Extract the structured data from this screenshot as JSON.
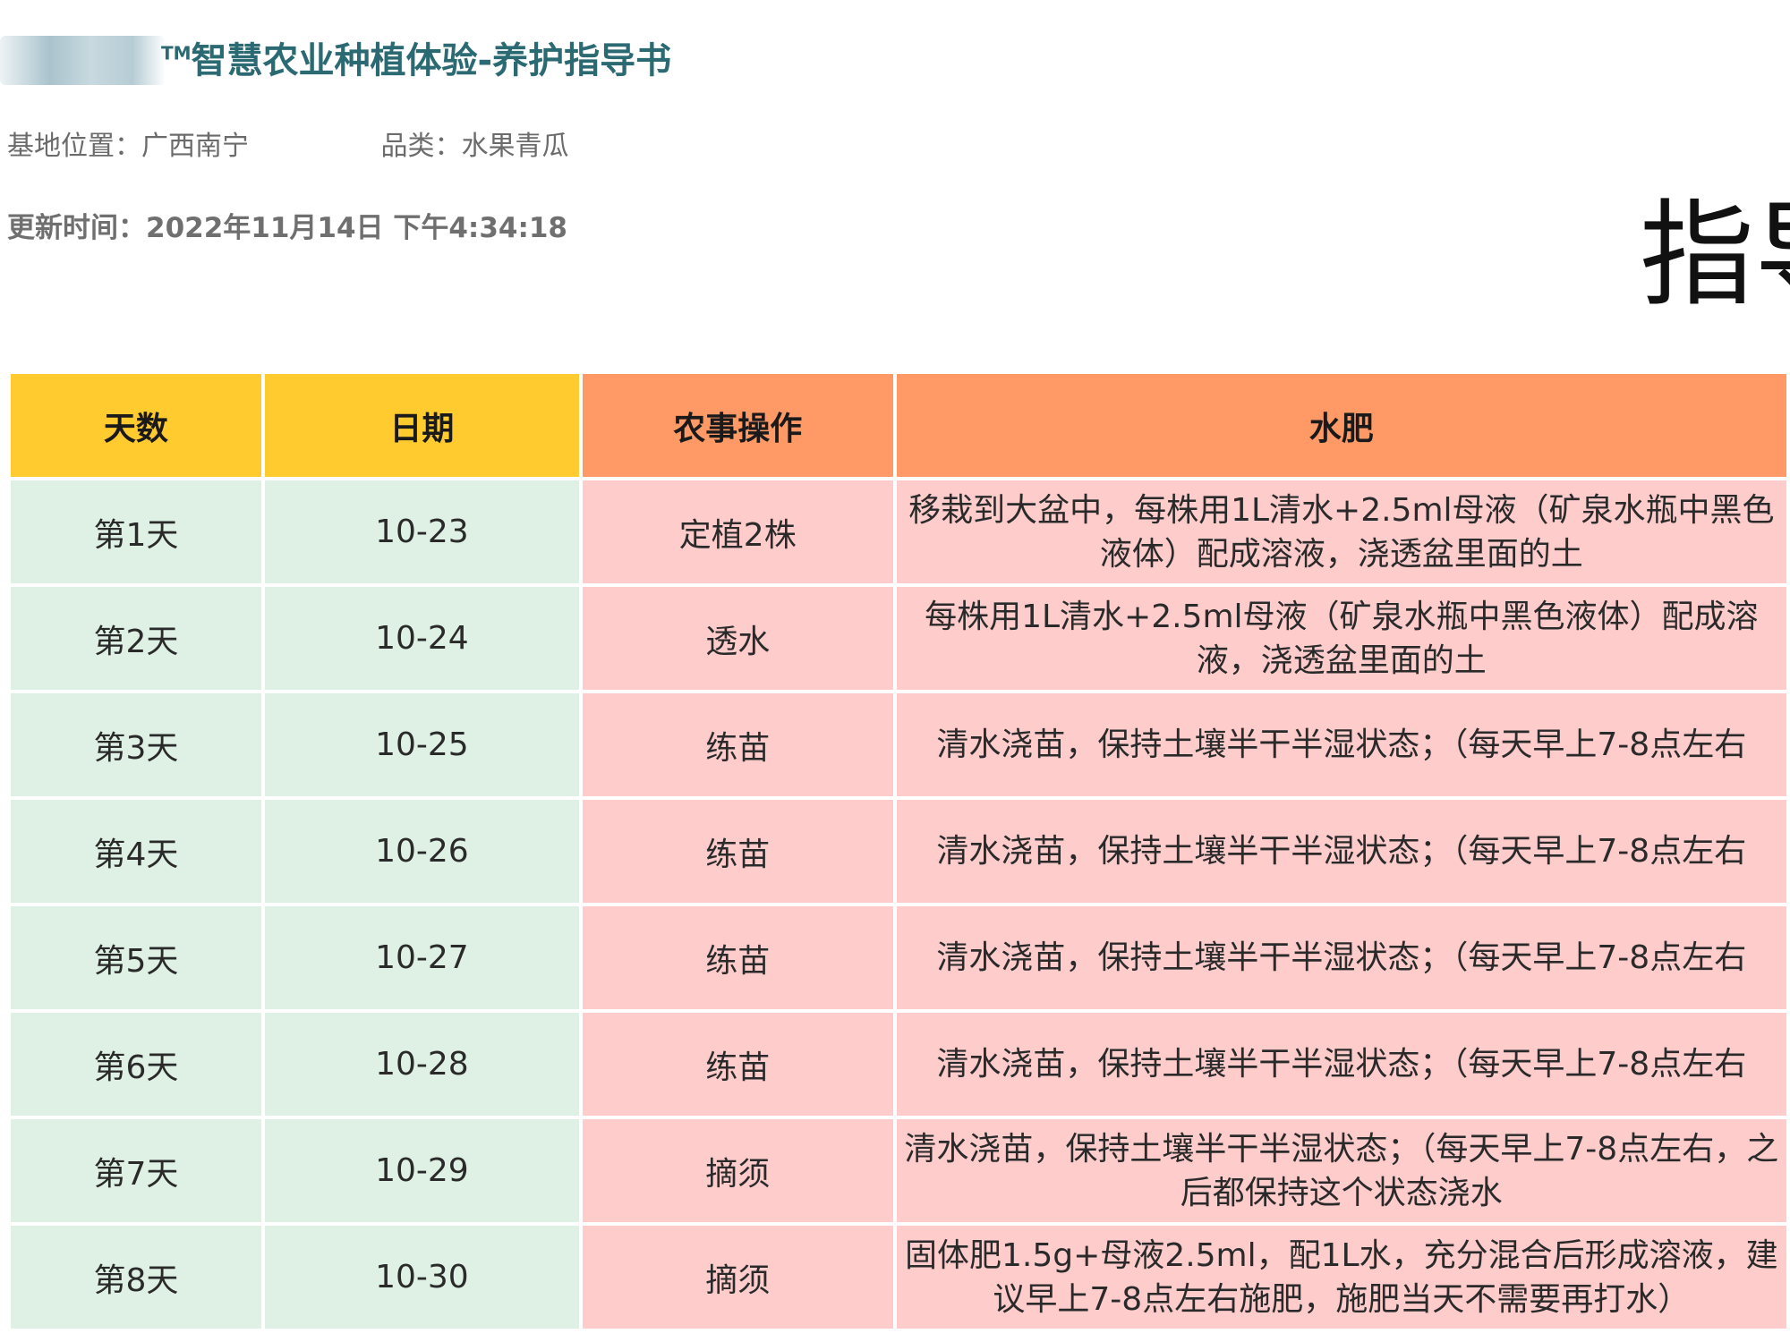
{
  "header": {
    "tm": "TM",
    "title": "智慧农业种植体验-养护指导书"
  },
  "meta": {
    "location_label": "基地位置：",
    "location_value": "广西南宁",
    "category_label": "品类：",
    "category_value": "水果青瓜",
    "updated_label": "更新时间：",
    "updated_value": "2022年11月14日 下午4:34:18"
  },
  "side_heading": "指导",
  "colors": {
    "title": "#2b6a72",
    "header_yellow": "#ffcb2e",
    "header_orange": "#ff9a67",
    "cell_green": "#dff1e5",
    "cell_pink": "#ffcccc"
  },
  "table": {
    "headers": {
      "day": "天数",
      "date": "日期",
      "operation": "农事操作",
      "fertilizer": "水肥"
    },
    "rows": [
      {
        "day": "第1天",
        "date": "10-23",
        "operation": "定植2株",
        "fertilizer": "移栽到大盆中，每株用1L清水+2.5ml母液（矿泉水瓶中黑色液体）配成溶液，浇透盆里面的土"
      },
      {
        "day": "第2天",
        "date": "10-24",
        "operation": "透水",
        "fertilizer": "每株用1L清水+2.5ml母液（矿泉水瓶中黑色液体）配成溶液，浇透盆里面的土"
      },
      {
        "day": "第3天",
        "date": "10-25",
        "operation": "练苗",
        "fertilizer": "清水浇苗，保持土壤半干半湿状态；（每天早上7-8点左右"
      },
      {
        "day": "第4天",
        "date": "10-26",
        "operation": "练苗",
        "fertilizer": "清水浇苗，保持土壤半干半湿状态；（每天早上7-8点左右"
      },
      {
        "day": "第5天",
        "date": "10-27",
        "operation": "练苗",
        "fertilizer": "清水浇苗，保持土壤半干半湿状态；（每天早上7-8点左右"
      },
      {
        "day": "第6天",
        "date": "10-28",
        "operation": "练苗",
        "fertilizer": "清水浇苗，保持土壤半干半湿状态；（每天早上7-8点左右"
      },
      {
        "day": "第7天",
        "date": "10-29",
        "operation": "摘须",
        "fertilizer": "清水浇苗，保持土壤半干半湿状态；（每天早上7-8点左右，之后都保持这个状态浇水"
      },
      {
        "day": "第8天",
        "date": "10-30",
        "operation": "摘须",
        "fertilizer": "固体肥1.5g+母液2.5ml，配1L水，充分混合后形成溶液，建议早上7-8点左右施肥，施肥当天不需要再打水）"
      }
    ]
  }
}
